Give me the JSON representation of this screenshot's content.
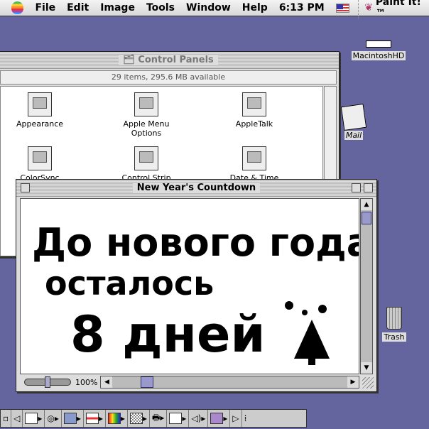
{
  "menubar": {
    "items": [
      "File",
      "Edit",
      "Image",
      "Tools",
      "Window",
      "Help"
    ],
    "time": "6:13 PM",
    "app_name": "Paint It!™"
  },
  "control_panels": {
    "title": "Control Panels",
    "info": "29 items, 295.6 MB available",
    "items": [
      "Appearance",
      "Apple Menu Options",
      "AppleTalk",
      "ColorSync",
      "Control Strip",
      "Date & Time"
    ]
  },
  "countdown": {
    "title": "New Year's Countdown",
    "zoom": "100%",
    "drawing": {
      "line1": "До нового года",
      "line2": "осталось",
      "line3": "8 дней"
    }
  },
  "desktop": {
    "hd_label": "MacintoshHD",
    "mail_label": "Mail",
    "trash_label": "Trash"
  },
  "colors": {
    "desktop": "#64649e",
    "scroll_thumb": "#9999cc"
  }
}
